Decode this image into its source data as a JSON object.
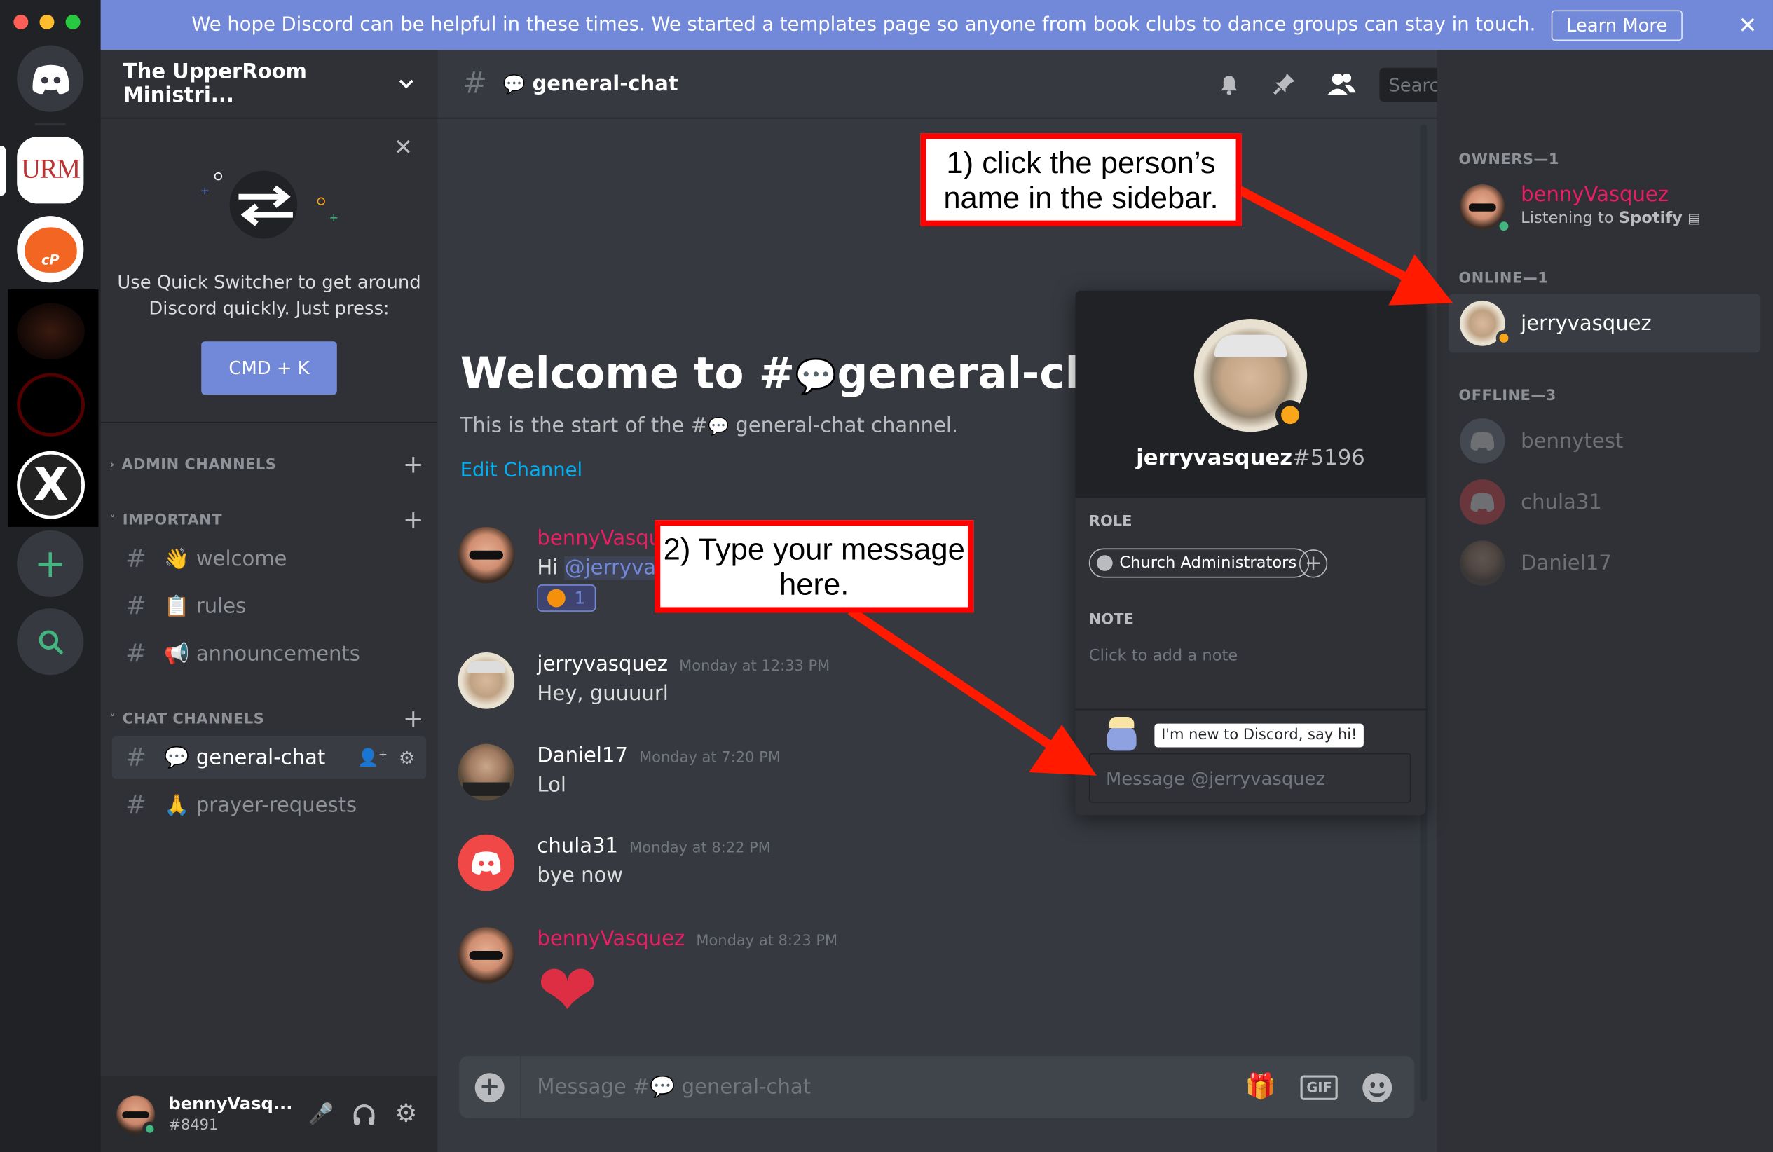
{
  "banner": {
    "text": "We hope Discord can be helpful in these times. We started a templates page so anyone from book clubs to dance groups can stay in touch.",
    "button": "Learn More",
    "close": "✕"
  },
  "rail": {
    "urm_label": "URM",
    "cp_label": "cP"
  },
  "sidebar": {
    "guild_name": "The UpperRoom Ministri...",
    "tip_text_1": "Use Quick Switcher to get around",
    "tip_text_2": "Discord quickly. Just press:",
    "tip_button": "CMD + K",
    "categories": [
      {
        "name": "ADMIN CHANNELS"
      },
      {
        "name": "IMPORTANT"
      },
      {
        "name": "CHAT CHANNELS"
      }
    ],
    "channels": [
      {
        "emoji": "👋",
        "name": "welcome"
      },
      {
        "emoji": "📋",
        "name": "rules"
      },
      {
        "emoji": "📢",
        "name": "announcements"
      },
      {
        "emoji": "💬",
        "name": "general-chat"
      },
      {
        "emoji": "🙏",
        "name": "prayer-requests"
      }
    ],
    "user": {
      "name": "bennyVasq...",
      "tag": "#8491"
    }
  },
  "header": {
    "channel_name": "general-chat",
    "search_placeholder": "Search"
  },
  "welcome": {
    "title_prefix": "Welcome to #",
    "title_channel": "general-chat!",
    "subtitle_prefix": "This is the start of the #",
    "subtitle_suffix": " general-chat channel.",
    "edit_link": "Edit Channel"
  },
  "messages": [
    {
      "author": "bennyVasquez",
      "time": "",
      "text_prefix": "Hi ",
      "mention": "@jerryvasquez",
      "reaction_count": "1"
    },
    {
      "author": "jerryvasquez",
      "time": "Monday at 12:33 PM",
      "text": "Hey, guuuurl"
    },
    {
      "author": "Daniel17",
      "time": "Monday at 7:20 PM",
      "text": "Lol"
    },
    {
      "author": "chula31",
      "time": "Monday at 8:22 PM",
      "text": "bye now"
    },
    {
      "author": "bennyVasquez",
      "time": "Monday at 8:23 PM",
      "text": "❤"
    }
  ],
  "composer": {
    "placeholder": "Message #💬 general-chat",
    "gif": "GIF"
  },
  "members": {
    "owners_header": "OWNERS—1",
    "online_header": "ONLINE—1",
    "offline_header": "OFFLINE—3",
    "owner": {
      "name": "bennyVasquez",
      "activity_prefix": "Listening to ",
      "activity_app": "Spotify"
    },
    "online": [
      {
        "name": "jerryvasquez"
      }
    ],
    "offline": [
      {
        "name": "bennytest"
      },
      {
        "name": "chula31"
      },
      {
        "name": "Daniel17"
      }
    ]
  },
  "popout": {
    "username": "jerryvasquez",
    "discriminator": "#5196",
    "role_header": "ROLE",
    "role": "Church Administrators",
    "note_header": "NOTE",
    "note_placeholder": "Click to add a note",
    "hint": "I'm new to Discord, say hi!",
    "message_placeholder": "Message @jerryvasquez"
  },
  "callouts": {
    "one_line1": "1) click the person’s",
    "one_line2": "name in the sidebar.",
    "two_line1": "2) Type your message",
    "two_line2": "here."
  },
  "colors": {
    "blurple": "#7289da",
    "owner_name": "#e91e63",
    "online": "#43b581",
    "idle": "#faa61a",
    "callout_red": "#ff0000"
  }
}
